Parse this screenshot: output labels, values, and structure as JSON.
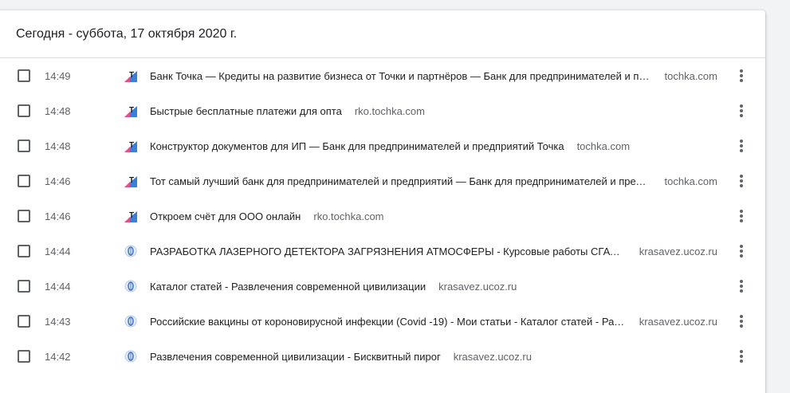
{
  "history": {
    "day_header": "Сегодня - суббота, 17 октября 2020 г.",
    "entries": [
      {
        "time": "14:49",
        "title": "Банк Точка — Кредиты на развитие бизнеса от Точки и партнёров — Банк для предпринимателей и предприятий Точка",
        "domain": "tochka.com",
        "favicon": "tochka-icon"
      },
      {
        "time": "14:48",
        "title": "Быстрые бесплатные платежи для опта",
        "domain": "rko.tochka.com",
        "favicon": "tochka-icon"
      },
      {
        "time": "14:48",
        "title": "Конструктор документов для ИП — Банк для предпринимателей и предприятий Точка",
        "domain": "tochka.com",
        "favicon": "tochka-icon"
      },
      {
        "time": "14:46",
        "title": "Тот самый лучший банк для предпринимателей и предприятий — Банк для предпринимателей и предприятий Точка",
        "domain": "tochka.com",
        "favicon": "tochka-icon"
      },
      {
        "time": "14:46",
        "title": "Откроем счёт для ООО онлайн",
        "domain": "rko.tochka.com",
        "favicon": "tochka-icon"
      },
      {
        "time": "14:44",
        "title": "РАЗРАБОТКА ЛАЗЕРНОГО ДЕТЕКТОРА ЗАГРЯЗНЕНИЯ АТМОСФЕРЫ - Курсовые работы СГАУ имени Королёва",
        "domain": "krasavez.ucoz.ru",
        "favicon": "ucoz-icon"
      },
      {
        "time": "14:44",
        "title": "Каталог статей - Развлечения современной цивилизации",
        "domain": "krasavez.ucoz.ru",
        "favicon": "ucoz-icon"
      },
      {
        "time": "14:43",
        "title": "Российские вакцины от короновирусной инфекции (Covid -19) - Мои статьи - Каталог статей - Развлечения",
        "domain": "krasavez.ucoz.ru",
        "favicon": "ucoz-icon"
      },
      {
        "time": "14:42",
        "title": "Развлечения современной цивилизации - Бисквитный пирог",
        "domain": "krasavez.ucoz.ru",
        "favicon": "ucoz-icon"
      }
    ]
  },
  "colors": {
    "page_background": "#f1f3f4",
    "card_background": "#ffffff",
    "primary_text": "#202124",
    "secondary_text": "#5f6368",
    "divider": "#dadce0"
  }
}
